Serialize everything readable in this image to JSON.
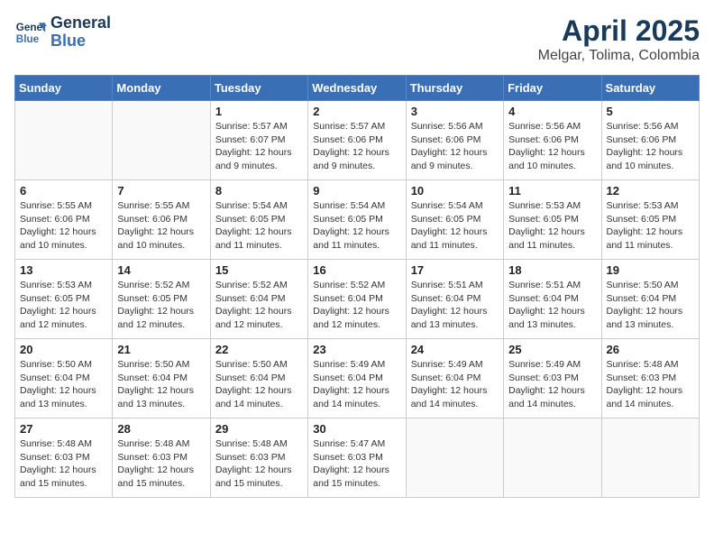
{
  "logo": {
    "line1": "General",
    "line2": "Blue"
  },
  "title": "April 2025",
  "subtitle": "Melgar, Tolima, Colombia",
  "days_header": [
    "Sunday",
    "Monday",
    "Tuesday",
    "Wednesday",
    "Thursday",
    "Friday",
    "Saturday"
  ],
  "weeks": [
    [
      {
        "day": "",
        "info": ""
      },
      {
        "day": "",
        "info": ""
      },
      {
        "day": "1",
        "info": "Sunrise: 5:57 AM\nSunset: 6:07 PM\nDaylight: 12 hours and 9 minutes."
      },
      {
        "day": "2",
        "info": "Sunrise: 5:57 AM\nSunset: 6:06 PM\nDaylight: 12 hours and 9 minutes."
      },
      {
        "day": "3",
        "info": "Sunrise: 5:56 AM\nSunset: 6:06 PM\nDaylight: 12 hours and 9 minutes."
      },
      {
        "day": "4",
        "info": "Sunrise: 5:56 AM\nSunset: 6:06 PM\nDaylight: 12 hours and 10 minutes."
      },
      {
        "day": "5",
        "info": "Sunrise: 5:56 AM\nSunset: 6:06 PM\nDaylight: 12 hours and 10 minutes."
      }
    ],
    [
      {
        "day": "6",
        "info": "Sunrise: 5:55 AM\nSunset: 6:06 PM\nDaylight: 12 hours and 10 minutes."
      },
      {
        "day": "7",
        "info": "Sunrise: 5:55 AM\nSunset: 6:06 PM\nDaylight: 12 hours and 10 minutes."
      },
      {
        "day": "8",
        "info": "Sunrise: 5:54 AM\nSunset: 6:05 PM\nDaylight: 12 hours and 11 minutes."
      },
      {
        "day": "9",
        "info": "Sunrise: 5:54 AM\nSunset: 6:05 PM\nDaylight: 12 hours and 11 minutes."
      },
      {
        "day": "10",
        "info": "Sunrise: 5:54 AM\nSunset: 6:05 PM\nDaylight: 12 hours and 11 minutes."
      },
      {
        "day": "11",
        "info": "Sunrise: 5:53 AM\nSunset: 6:05 PM\nDaylight: 12 hours and 11 minutes."
      },
      {
        "day": "12",
        "info": "Sunrise: 5:53 AM\nSunset: 6:05 PM\nDaylight: 12 hours and 11 minutes."
      }
    ],
    [
      {
        "day": "13",
        "info": "Sunrise: 5:53 AM\nSunset: 6:05 PM\nDaylight: 12 hours and 12 minutes."
      },
      {
        "day": "14",
        "info": "Sunrise: 5:52 AM\nSunset: 6:05 PM\nDaylight: 12 hours and 12 minutes."
      },
      {
        "day": "15",
        "info": "Sunrise: 5:52 AM\nSunset: 6:04 PM\nDaylight: 12 hours and 12 minutes."
      },
      {
        "day": "16",
        "info": "Sunrise: 5:52 AM\nSunset: 6:04 PM\nDaylight: 12 hours and 12 minutes."
      },
      {
        "day": "17",
        "info": "Sunrise: 5:51 AM\nSunset: 6:04 PM\nDaylight: 12 hours and 13 minutes."
      },
      {
        "day": "18",
        "info": "Sunrise: 5:51 AM\nSunset: 6:04 PM\nDaylight: 12 hours and 13 minutes."
      },
      {
        "day": "19",
        "info": "Sunrise: 5:50 AM\nSunset: 6:04 PM\nDaylight: 12 hours and 13 minutes."
      }
    ],
    [
      {
        "day": "20",
        "info": "Sunrise: 5:50 AM\nSunset: 6:04 PM\nDaylight: 12 hours and 13 minutes."
      },
      {
        "day": "21",
        "info": "Sunrise: 5:50 AM\nSunset: 6:04 PM\nDaylight: 12 hours and 13 minutes."
      },
      {
        "day": "22",
        "info": "Sunrise: 5:50 AM\nSunset: 6:04 PM\nDaylight: 12 hours and 14 minutes."
      },
      {
        "day": "23",
        "info": "Sunrise: 5:49 AM\nSunset: 6:04 PM\nDaylight: 12 hours and 14 minutes."
      },
      {
        "day": "24",
        "info": "Sunrise: 5:49 AM\nSunset: 6:04 PM\nDaylight: 12 hours and 14 minutes."
      },
      {
        "day": "25",
        "info": "Sunrise: 5:49 AM\nSunset: 6:03 PM\nDaylight: 12 hours and 14 minutes."
      },
      {
        "day": "26",
        "info": "Sunrise: 5:48 AM\nSunset: 6:03 PM\nDaylight: 12 hours and 14 minutes."
      }
    ],
    [
      {
        "day": "27",
        "info": "Sunrise: 5:48 AM\nSunset: 6:03 PM\nDaylight: 12 hours and 15 minutes."
      },
      {
        "day": "28",
        "info": "Sunrise: 5:48 AM\nSunset: 6:03 PM\nDaylight: 12 hours and 15 minutes."
      },
      {
        "day": "29",
        "info": "Sunrise: 5:48 AM\nSunset: 6:03 PM\nDaylight: 12 hours and 15 minutes."
      },
      {
        "day": "30",
        "info": "Sunrise: 5:47 AM\nSunset: 6:03 PM\nDaylight: 12 hours and 15 minutes."
      },
      {
        "day": "",
        "info": ""
      },
      {
        "day": "",
        "info": ""
      },
      {
        "day": "",
        "info": ""
      }
    ]
  ]
}
